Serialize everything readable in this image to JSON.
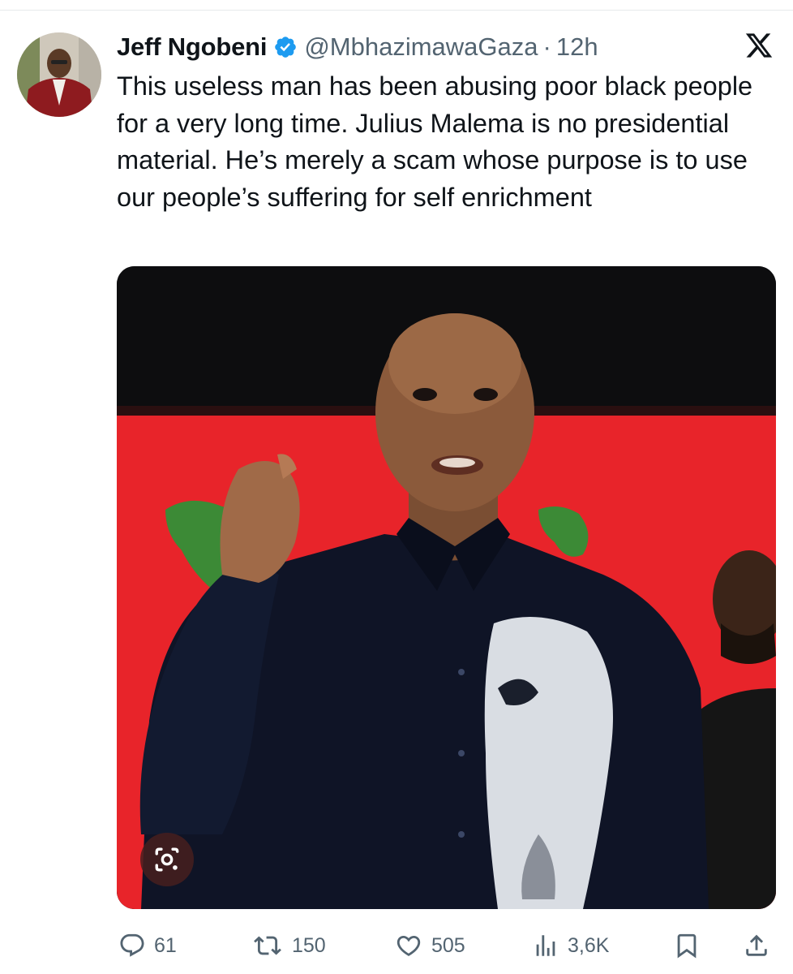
{
  "tweet": {
    "author": {
      "display_name": "Jeff Ngobeni",
      "handle": "@MbhazimawaGaza",
      "verified": true
    },
    "separator": "·",
    "time": "12h",
    "text": "This useless man has been abusing poor black people for a very long time. Julius Malema is no presidential material. He’s merely a scam whose purpose is to use our people’s suffering for self enrichment"
  },
  "actions": {
    "replies": "61",
    "reposts": "150",
    "likes": "505",
    "views": "3,6K"
  },
  "colors": {
    "verified_badge": "#1d9bf0",
    "secondary_text": "#536471",
    "primary_text": "#0f1419",
    "banner_red": "#e8242a"
  },
  "icons": [
    "x-logo-icon",
    "verified-badge-icon",
    "google-lens-icon",
    "reply-icon",
    "repost-icon",
    "like-icon",
    "views-icon",
    "bookmark-icon",
    "share-icon"
  ]
}
